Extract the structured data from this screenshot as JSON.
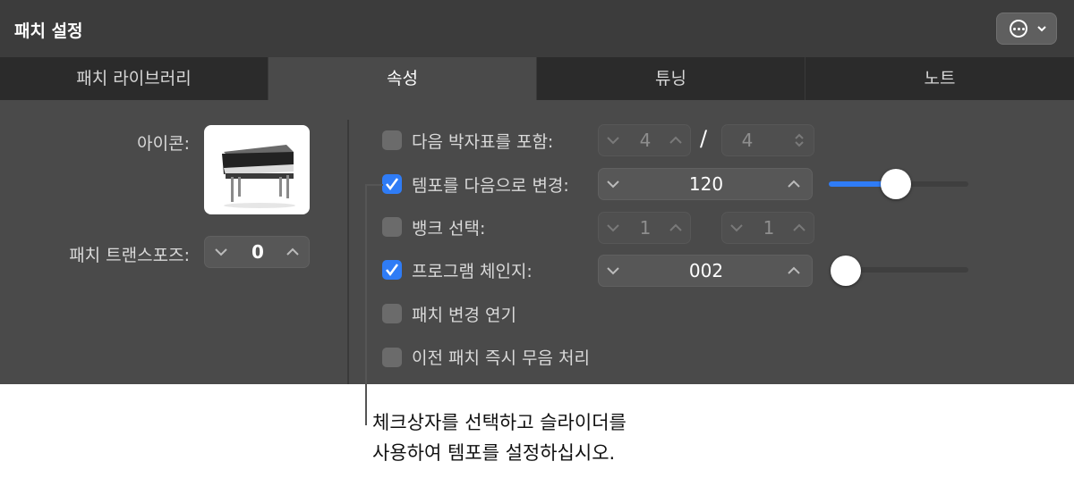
{
  "header": {
    "title": "패치 설정",
    "more_icon": "ellipsis-circle-icon"
  },
  "tabs": [
    {
      "label": "패치 라이브러리",
      "active": false
    },
    {
      "label": "속성",
      "active": true
    },
    {
      "label": "튜닝",
      "active": false
    },
    {
      "label": "노트",
      "active": false
    }
  ],
  "left": {
    "icon_label": "아이콘:",
    "icon_image": "electric-piano-icon",
    "transpose_label": "패치 트랜스포즈:",
    "transpose_value": "0"
  },
  "options": {
    "time_signature": {
      "label": "다음 박자표를 포함:",
      "checked": false,
      "numerator": "4",
      "separator": "/",
      "denominator": "4"
    },
    "tempo": {
      "label": "템포를 다음으로 변경:",
      "checked": true,
      "value": "120",
      "slider_level": 0.43
    },
    "bank_select": {
      "label": "뱅크 선택:",
      "checked": false,
      "msb": "1",
      "lsb": "1"
    },
    "program_change": {
      "label": "프로그램 체인지:",
      "checked": true,
      "value": "002",
      "slider_level": 0.0
    },
    "delay_patch_change": {
      "label": "패치 변경 연기",
      "checked": false
    },
    "instant_mute_previous": {
      "label": "이전 패치 즉시 무음 처리",
      "checked": false
    }
  },
  "callout": {
    "line1": "체크상자를 선택하고 슬라이더를",
    "line2": "사용하여 템포를 설정하십시오."
  },
  "colors": {
    "accent": "#2f7cf6",
    "panel": "#4a4a4a",
    "titlebar": "#3c3c3c",
    "tabbar": "#2b2b2b"
  }
}
